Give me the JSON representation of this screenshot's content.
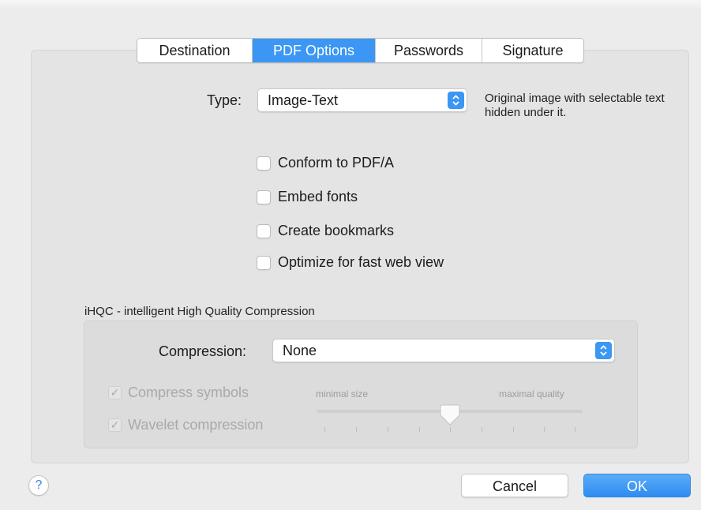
{
  "tabs": [
    {
      "label": "Destination",
      "active": false
    },
    {
      "label": "PDF Options",
      "active": true
    },
    {
      "label": "Passwords",
      "active": false
    },
    {
      "label": "Signature",
      "active": false
    }
  ],
  "type_field": {
    "label": "Type:",
    "value": "Image-Text",
    "description": "Original image with selectable text hidden under it."
  },
  "options": [
    {
      "label": "Conform to PDF/A",
      "checked": false
    },
    {
      "label": "Embed fonts",
      "checked": false
    },
    {
      "label": "Create bookmarks",
      "checked": false
    },
    {
      "label": "Optimize for fast web view",
      "checked": false
    }
  ],
  "ihqc": {
    "title": "iHQC - intelligent High Quality Compression",
    "compression_label": "Compression:",
    "compression_value": "None",
    "compress_symbols": {
      "label": "Compress symbols",
      "checked": true,
      "enabled": false
    },
    "wavelet_compression": {
      "label": "Wavelet compression",
      "checked": true,
      "enabled": false
    },
    "slider": {
      "min_label": "minimal size",
      "max_label": "maximal quality",
      "steps": 9,
      "selected_index": 4
    }
  },
  "footer": {
    "help": "?",
    "cancel_label": "Cancel",
    "ok_label": "OK"
  },
  "colors": {
    "accent": "#3b97f3",
    "disabled_text": "#a9a9a9"
  },
  "icons": {
    "stepper": "up-down-chevron-icon",
    "check": "checkmark-icon",
    "help": "question-mark-icon"
  }
}
